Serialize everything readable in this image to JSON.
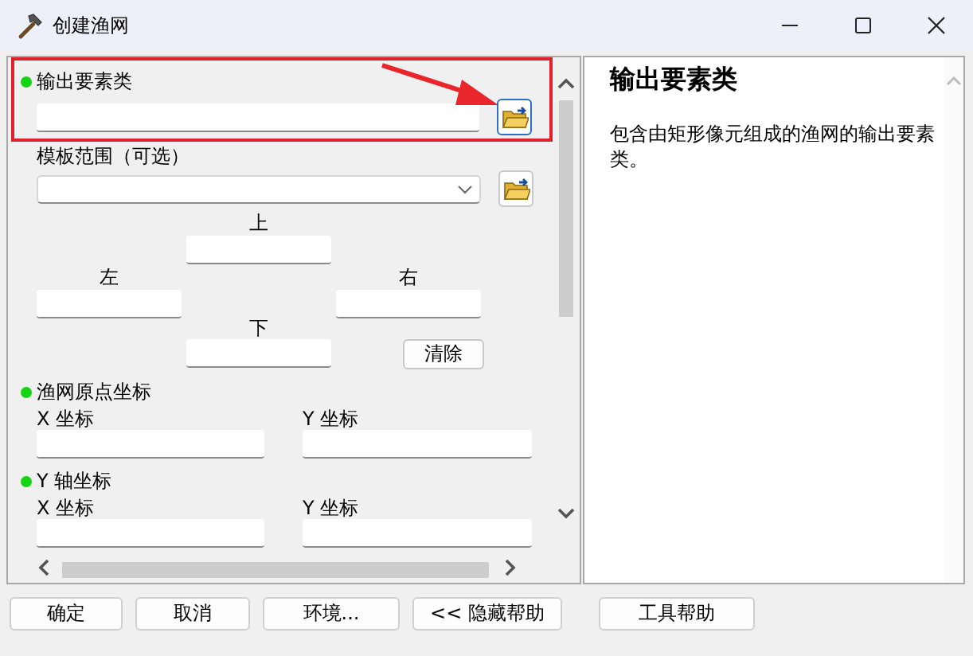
{
  "window": {
    "title": "创建渔网"
  },
  "parameters": [
    {
      "kind": "output",
      "label": "输出要素类",
      "required": true,
      "highlighted": true
    },
    {
      "kind": "extent",
      "label": "模板范围（可选）",
      "required": false,
      "highlighted": false,
      "top": "上",
      "left": "左",
      "right": "右",
      "bottom": "下",
      "clear_button": "清除"
    },
    {
      "kind": "point",
      "label": "渔网原点坐标",
      "required": true,
      "highlighted": false,
      "fields": [
        {
          "label": "X 坐标"
        },
        {
          "label": "Y 坐标"
        }
      ]
    },
    {
      "kind": "point",
      "label": "Y 轴坐标",
      "required": true,
      "highlighted": false,
      "fields": [
        {
          "label": "X 坐标"
        },
        {
          "label": "Y 坐标"
        }
      ]
    }
  ],
  "help": {
    "title": "输出要素类",
    "text": "包含由矩形像元组成的渔网的输出要素类。"
  },
  "buttons": [
    {
      "label": "确定"
    },
    {
      "label": "取消"
    },
    {
      "label": "环境..."
    },
    {
      "label": "<< 隐藏帮助"
    }
  ],
  "help_button": "工具帮助"
}
